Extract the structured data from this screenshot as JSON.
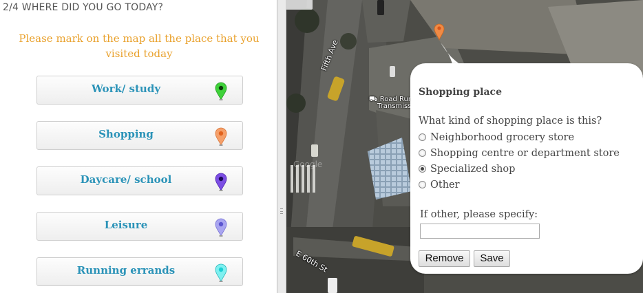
{
  "header": {
    "step_title": "2/4 WHERE DID YOU GO TODAY?",
    "instructions": "Please mark on the map all the place that you visited today"
  },
  "categories": [
    {
      "label": "Work/ study",
      "pin_color": "#3fd23a"
    },
    {
      "label": "Shopping",
      "pin_color": "#f08a45"
    },
    {
      "label": "Daycare/ school",
      "pin_color": "#6a33d6"
    },
    {
      "label": "Leisure",
      "pin_color": "#8b86e8"
    },
    {
      "label": "Running errands",
      "pin_color": "#37e4e6"
    }
  ],
  "map": {
    "street_label_1": "Fifth Ave",
    "street_label_2": "E 60th St",
    "poi_label_line1": "Road Runn",
    "poi_label_line2": "Transmissi",
    "watermark": "Google",
    "marker_color": "#f08a45"
  },
  "popup": {
    "title": "Shopping place",
    "question": "What kind of shopping place is this?",
    "options": [
      {
        "label": "Neighborhood grocery store",
        "checked": false
      },
      {
        "label": "Shopping centre or department store",
        "checked": false
      },
      {
        "label": "Specialized shop",
        "checked": true
      },
      {
        "label": "Other",
        "checked": false
      }
    ],
    "other_label": "If other, please specify:",
    "other_value": "",
    "remove_label": "Remove",
    "save_label": "Save"
  }
}
